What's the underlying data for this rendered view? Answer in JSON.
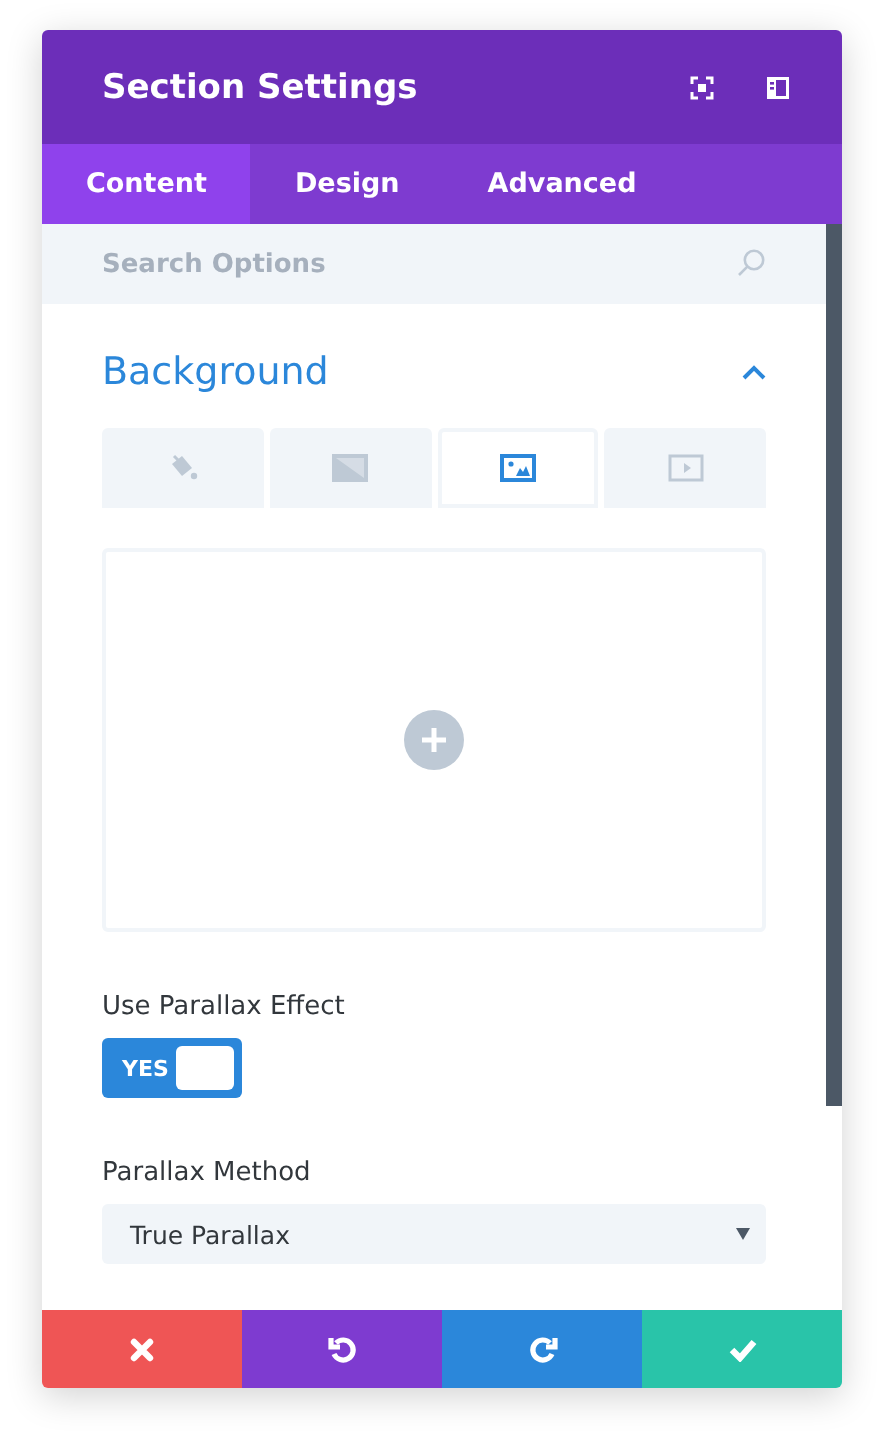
{
  "window": {
    "title": "Section Settings"
  },
  "header_actions": [
    {
      "kind": "expand"
    },
    {
      "kind": "sidebar"
    }
  ],
  "tabs": [
    {
      "label": "Content",
      "selected": true
    },
    {
      "label": "Design",
      "selected": false
    },
    {
      "label": "Advanced",
      "selected": false
    }
  ],
  "search": {
    "placeholder": "Search Options"
  },
  "section": {
    "title": "Background",
    "expanded": true,
    "background_types": [
      {
        "kind": "color",
        "selected": false
      },
      {
        "kind": "gradient",
        "selected": false
      },
      {
        "kind": "image",
        "selected": true
      },
      {
        "kind": "video",
        "selected": false
      }
    ],
    "parallax_toggle": {
      "label": "Use Parallax Effect",
      "on": true,
      "text": "YES"
    },
    "parallax_method": {
      "label": "Parallax Method",
      "value": "True Parallax"
    }
  },
  "footer_buttons": [
    {
      "kind": "cancel"
    },
    {
      "kind": "undo"
    },
    {
      "kind": "redo"
    },
    {
      "kind": "save"
    }
  ]
}
